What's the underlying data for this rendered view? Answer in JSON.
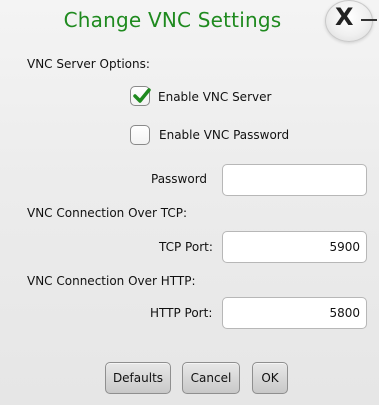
{
  "dialog": {
    "title": "Change VNC Settings",
    "close_label": "X"
  },
  "server_options": {
    "heading": "VNC Server Options:",
    "enable_server": {
      "label": "Enable VNC Server",
      "checked": true
    },
    "enable_password": {
      "label": "Enable VNC Password",
      "checked": false
    },
    "password": {
      "label": "Password",
      "value": ""
    }
  },
  "tcp": {
    "heading": "VNC Connection Over TCP:",
    "port_label": "TCP Port:",
    "port_value": "5900"
  },
  "http": {
    "heading": "VNC Connection Over HTTP:",
    "port_label": "HTTP Port:",
    "port_value": "5800"
  },
  "buttons": {
    "defaults": "Defaults",
    "cancel": "Cancel",
    "ok": "OK"
  },
  "colors": {
    "title": "#1f8a1f",
    "checkmark": "#1f8a1f"
  }
}
